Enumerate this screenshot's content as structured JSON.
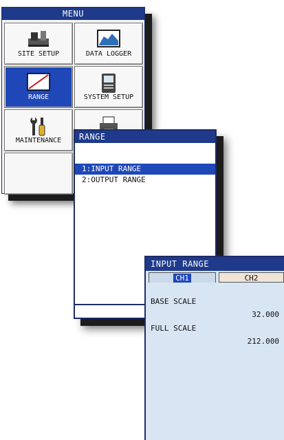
{
  "menu": {
    "title": "MENU",
    "items": [
      {
        "label": "SITE SETUP",
        "icon": "site-setup-icon",
        "selected": false
      },
      {
        "label": "DATA LOGGER",
        "icon": "data-logger-icon",
        "selected": false
      },
      {
        "label": "RANGE",
        "icon": "range-icon",
        "selected": true
      },
      {
        "label": "SYSTEM SETUP",
        "icon": "system-setup-icon",
        "selected": false
      },
      {
        "label": "MAINTENANCE",
        "icon": "maintenance-icon",
        "selected": false
      },
      {
        "label": "",
        "icon": "printer-icon",
        "selected": false
      },
      {
        "label": "",
        "icon": "",
        "selected": false
      }
    ]
  },
  "range": {
    "title": "RANGE",
    "items": [
      {
        "label": "1:INPUT RANGE",
        "active": true
      },
      {
        "label": "2:OUTPUT RANGE",
        "active": false
      }
    ]
  },
  "input_range": {
    "title": "INPUT RANGE",
    "tabs": [
      {
        "label": "CH1",
        "active": true
      },
      {
        "label": "CH2",
        "active": false
      }
    ],
    "base_scale_label": "BASE SCALE",
    "base_scale_value": "32.000",
    "full_scale_label": "FULL SCALE",
    "full_scale_value": "212.000"
  },
  "colors": {
    "titlebar": "#1f3a8a",
    "selection": "#1f47b8",
    "panel_bg": "#d8e5f2"
  }
}
